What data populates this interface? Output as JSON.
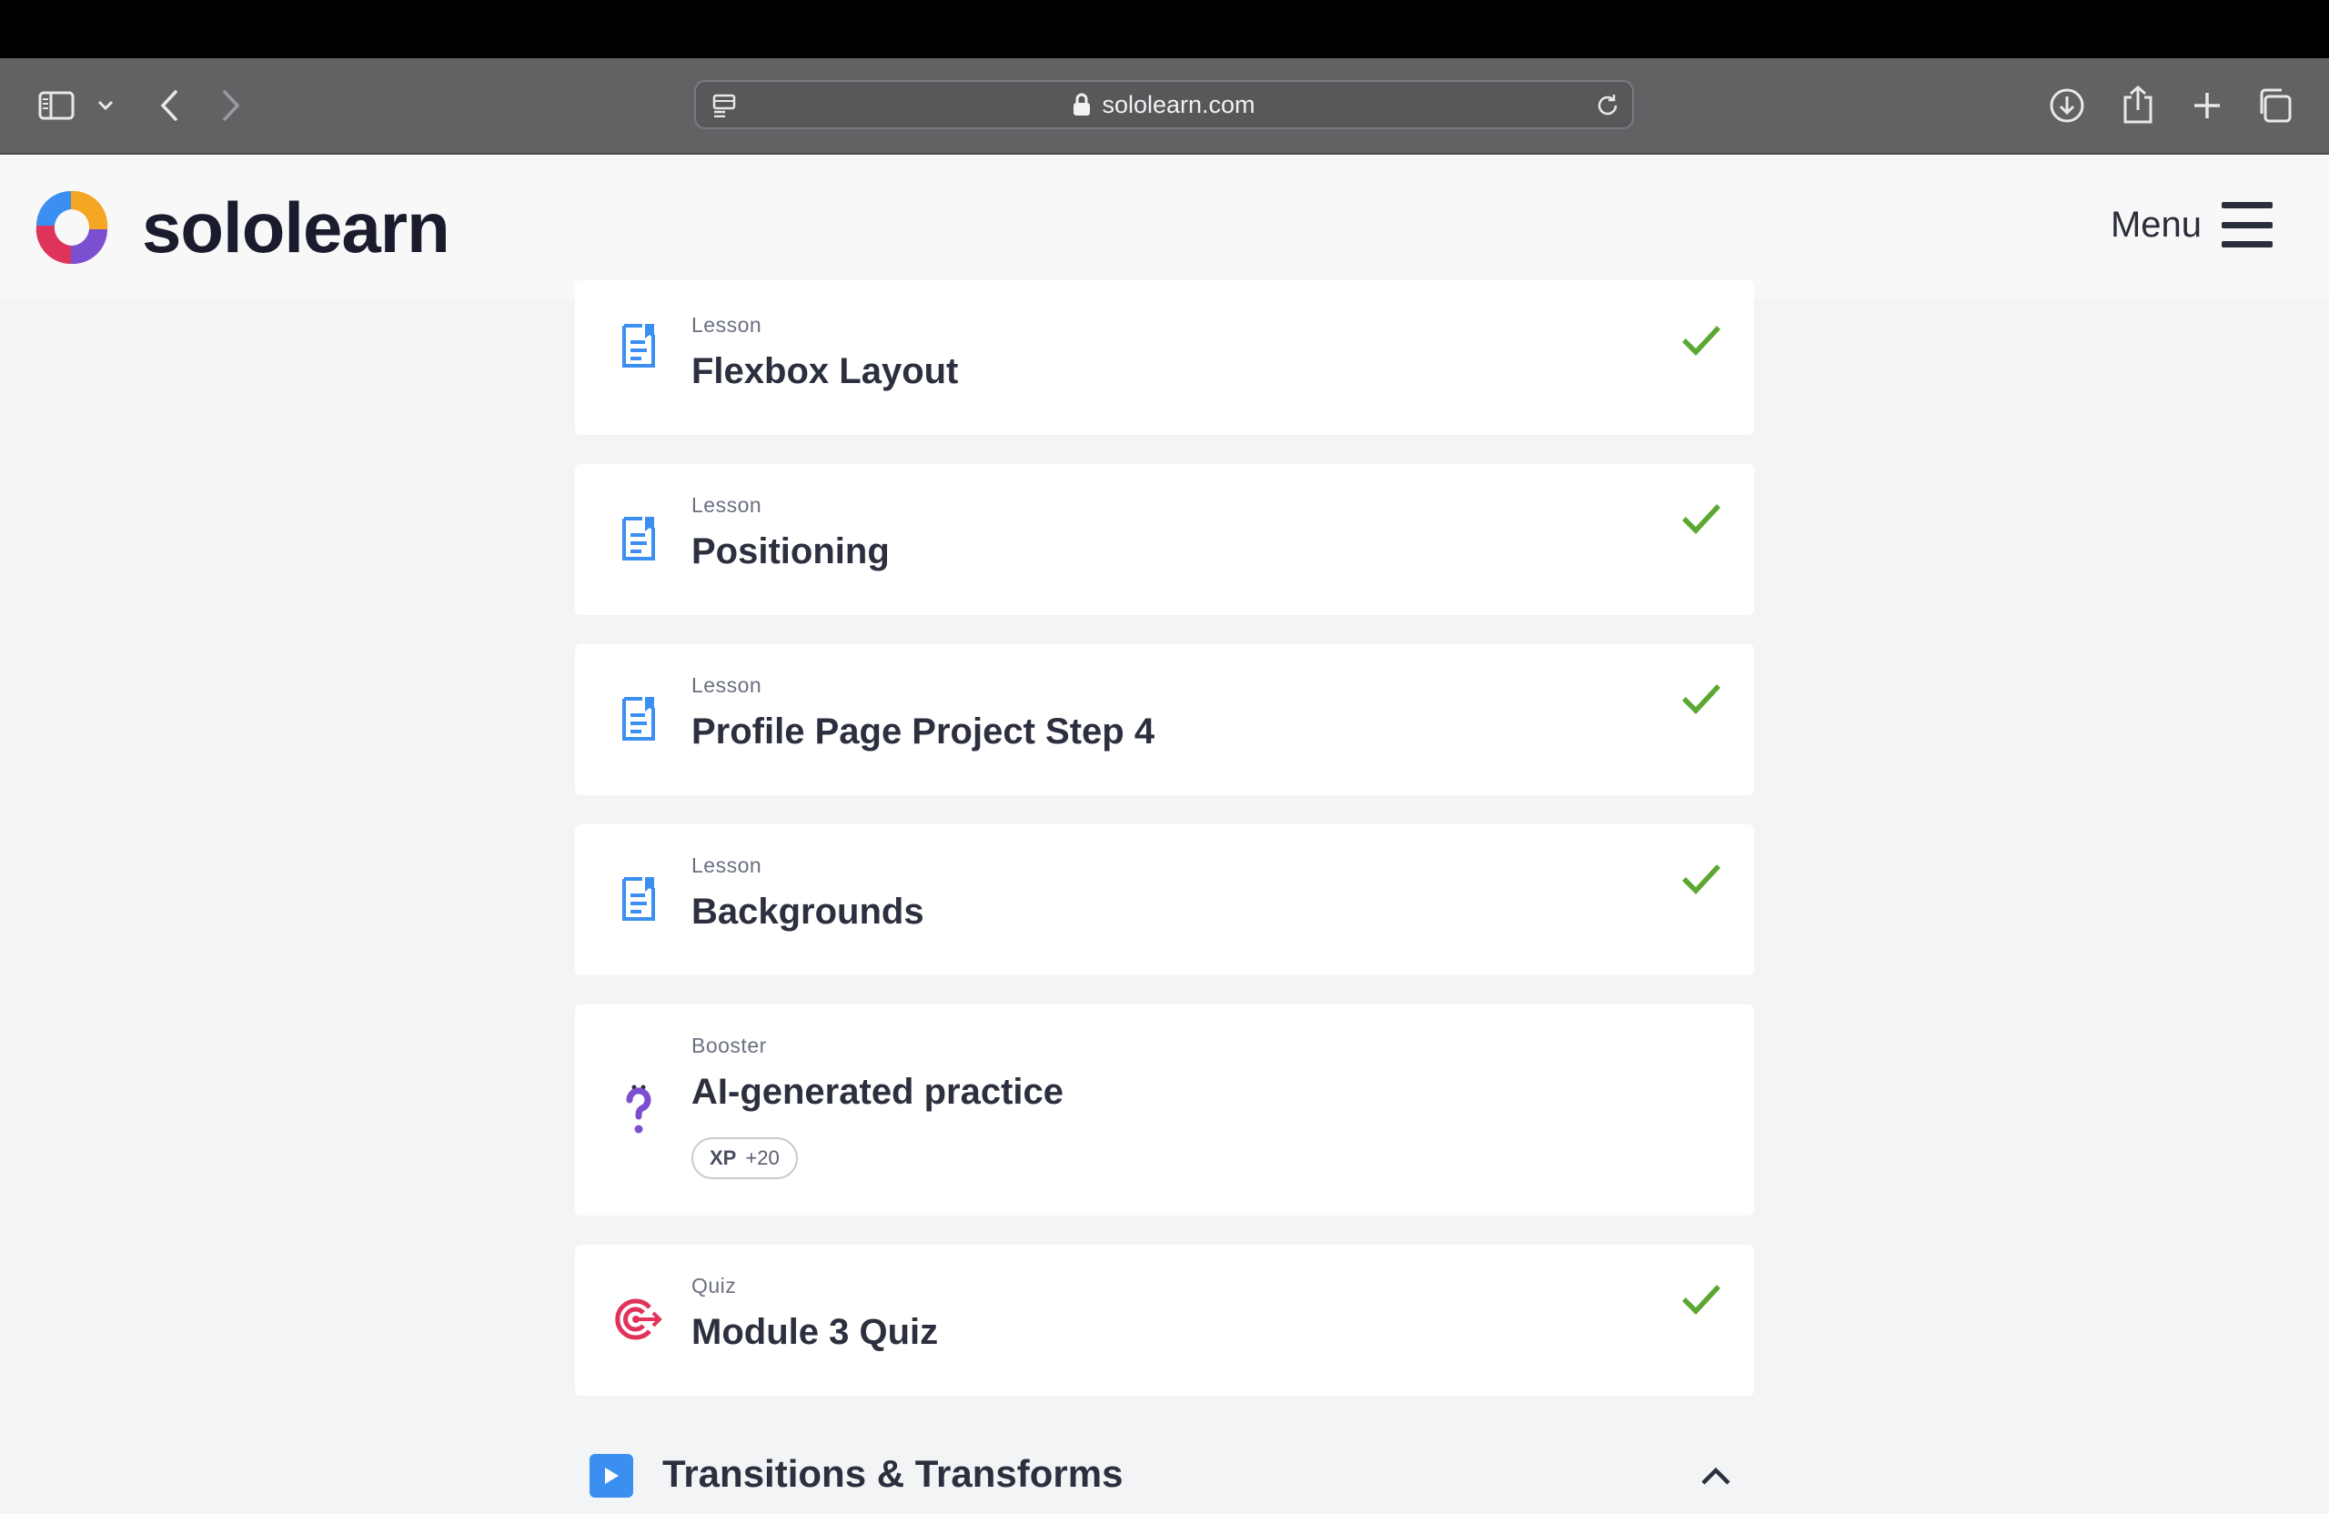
{
  "browser": {
    "url": "sololearn.com",
    "icons": [
      "sidebar-icon",
      "chevron-down-icon",
      "back-icon",
      "forward-icon",
      "reader-icon",
      "lock-icon",
      "reload-icon",
      "download-icon",
      "share-icon",
      "new-tab-icon",
      "tabs-icon"
    ]
  },
  "header": {
    "brand": "sololearn",
    "menu_label": "Menu"
  },
  "colors": {
    "lesson_icon": "#3a8ff0",
    "booster_icon": "#7b4fd0",
    "quiz_icon": "#e0335a",
    "check": "#5aa832"
  },
  "items": [
    {
      "type": "Lesson",
      "title": "Flexbox Layout",
      "completed": true,
      "icon": "lesson-icon"
    },
    {
      "type": "Lesson",
      "title": "Positioning",
      "completed": true,
      "icon": "lesson-icon"
    },
    {
      "type": "Lesson",
      "title": "Profile Page Project Step 4",
      "completed": true,
      "icon": "lesson-icon"
    },
    {
      "type": "Lesson",
      "title": "Backgrounds",
      "completed": true,
      "icon": "lesson-icon"
    },
    {
      "type": "Booster",
      "title": "AI-generated practice",
      "completed": false,
      "icon": "question-icon",
      "badge": {
        "label": "XP",
        "value": "+20"
      }
    },
    {
      "type": "Quiz",
      "title": "Module 3 Quiz",
      "completed": true,
      "icon": "target-icon"
    }
  ],
  "next_section": {
    "title": "Transitions & Transforms",
    "expanded": true
  }
}
